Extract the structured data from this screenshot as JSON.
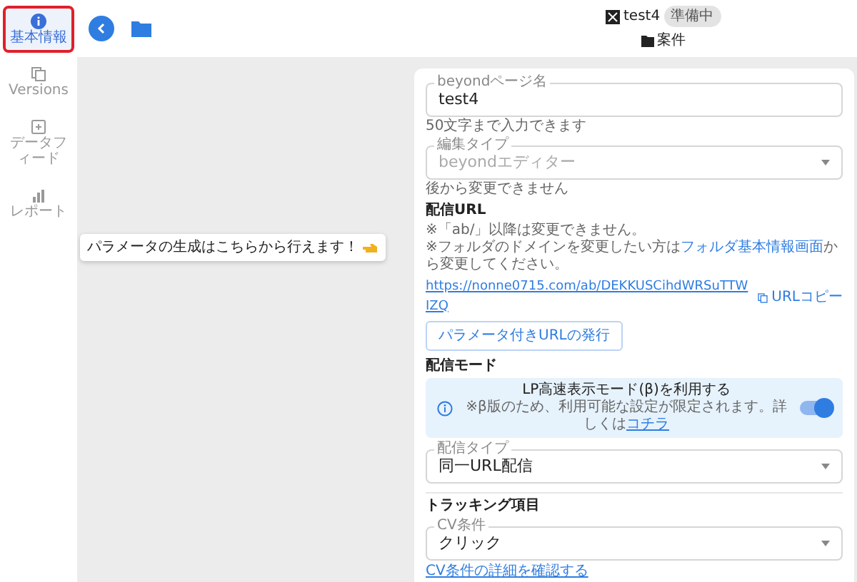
{
  "sidebar": {
    "items": [
      {
        "label": "基本情報",
        "selected": true,
        "highlighted": true
      },
      {
        "label": "Versions",
        "selected": false,
        "highlighted": false
      },
      {
        "label": "データフィード",
        "selected": false,
        "highlighted": false
      },
      {
        "label": "レポート",
        "selected": false,
        "highlighted": false
      }
    ]
  },
  "header": {
    "title": "test4",
    "status": "準備中",
    "folder": "案件"
  },
  "tooltip": {
    "text": "パラメータの生成はこちらから行えます！"
  },
  "form": {
    "page_name": {
      "label": "beyondページ名",
      "value": "test4",
      "helper": "50文字まで入力できます",
      "disabled": false
    },
    "edit_type": {
      "label": "編集タイプ",
      "value": "beyondエディター",
      "helper": "後から変更できません",
      "disabled": true
    },
    "url_section": {
      "heading": "配信URL",
      "note_1": "※「ab/」以降は変更できません。",
      "note_2_before": "※フォルダのドメインを変更したい方は",
      "note_2_link": "フォルダ基本情報画面",
      "note_2_after": "から変更してください。",
      "url": "https://nonne0715.com/ab/DEKKUSCihdWRSuTTWIZQ",
      "copy_label": "URLコピー",
      "param_button": "パラメータ付きURLの発行"
    },
    "mode_section": {
      "heading": "配信モード",
      "alert_title": "LP高速表示モード(β)を利用する",
      "alert_note": "※β版のため、利用可能な設定が限定されます。詳しくは",
      "alert_link": "コチラ",
      "toggle_on": true,
      "type_label": "配信タイプ",
      "type_value": "同一URL配信"
    },
    "tracking_section": {
      "heading": "トラッキング項目",
      "cv_label": "CV条件",
      "cv_value": "クリック",
      "detail_link": "CV条件の詳細を確認する"
    }
  }
}
